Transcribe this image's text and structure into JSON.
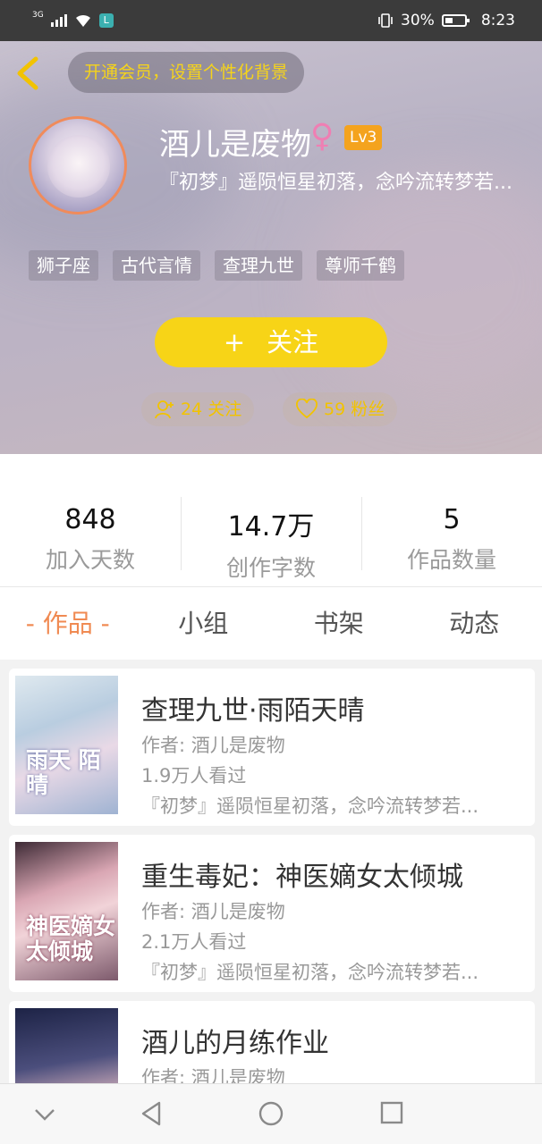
{
  "status_bar": {
    "network": "3G",
    "app_badge": "L",
    "battery_text": "30%",
    "time": "8:23"
  },
  "header": {
    "vip_banner": "开通会员，设置个性化背景",
    "username": "酒儿是废物",
    "gender_symbol": "♀",
    "level": "Lv3",
    "motto": "『初梦』遥陨恒星初落，念吟流转梦若...",
    "tags": [
      "狮子座",
      "古代言情",
      "查理九世",
      "尊师千鹤"
    ],
    "follow_button": "关注",
    "follow_plus": "+",
    "following": "24 关注",
    "fans": "59 粉丝",
    "colors": {
      "accent": "#f7d417",
      "level_badge": "#f4a31e",
      "female": "#ef7fb3"
    }
  },
  "stats": [
    {
      "value": "848",
      "label": "加入天数"
    },
    {
      "value": "14.7万",
      "label": "创作字数"
    },
    {
      "value": "5",
      "label": "作品数量"
    }
  ],
  "tabs": [
    {
      "label": "- 作品 -",
      "active": true
    },
    {
      "label": "小组",
      "active": false
    },
    {
      "label": "书架",
      "active": false
    },
    {
      "label": "动态",
      "active": false
    }
  ],
  "works": [
    {
      "title": "查理九世·雨陌天晴",
      "author": "作者: 酒儿是废物",
      "views": "1.9万人看过",
      "intro": "『初梦』遥陨恒星初落，念吟流转梦若...",
      "cover_caption": "雨天 陌晴"
    },
    {
      "title": "重生毒妃：神医嫡女太倾城",
      "author": "作者: 酒儿是废物",
      "views": "2.1万人看过",
      "intro": "『初梦』遥陨恒星初落，念吟流转梦若...",
      "cover_caption": "神医嫡女 太倾城"
    },
    {
      "title": "酒儿的月练作业",
      "author": "作者: 酒儿是废物",
      "views": "",
      "intro": "",
      "cover_caption": ""
    }
  ]
}
